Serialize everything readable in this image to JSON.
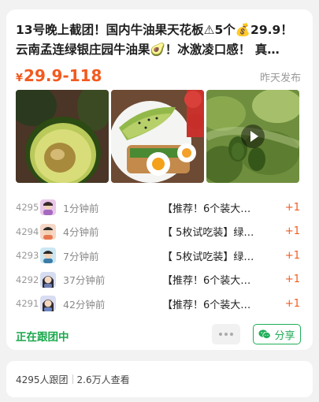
{
  "post": {
    "title_line1": "13号晚上截团！国内牛油果天花板⚠5个💰29.9！",
    "title_line2": "云南孟连绿银庄园牛油果🥑！冰激凌口感！ 真…",
    "price_currency": "¥",
    "price_range": "29.9-118",
    "posted_time": "昨天发布",
    "photos": [
      {
        "icon": "avocado-half-photo"
      },
      {
        "icon": "avocado-toast-photo"
      },
      {
        "icon": "avocado-tree-video",
        "has_play": true
      }
    ]
  },
  "orders": [
    {
      "num": "4295",
      "time": "1分钟前",
      "product": "【推荐！6个装大…",
      "qty": "+1",
      "avatar_bg": "#e9c7ea"
    },
    {
      "num": "4294",
      "time": "4分钟前",
      "product": "【 5枚试吃装】绿…",
      "qty": "+1",
      "avatar_bg": "#f6d7c6"
    },
    {
      "num": "4293",
      "time": "7分钟前",
      "product": "【 5枚试吃装】绿…",
      "qty": "+1",
      "avatar_bg": "#cbe7f2"
    },
    {
      "num": "4292",
      "time": "37分钟前",
      "product": "【推荐！6个装大…",
      "qty": "+1",
      "avatar_bg": "#d6ddf0"
    },
    {
      "num": "4291",
      "time": "42分钟前",
      "product": "【推荐！6个装大…",
      "qty": "+1",
      "avatar_bg": "#d8ddf2"
    }
  ],
  "actions": {
    "following_label": "正在跟团中",
    "share_label": "分享"
  },
  "footer": {
    "joined": "4295人跟团",
    "views": "2.6万人查看"
  },
  "colors": {
    "accent_orange": "#f25a1f",
    "accent_green": "#1fae57"
  }
}
